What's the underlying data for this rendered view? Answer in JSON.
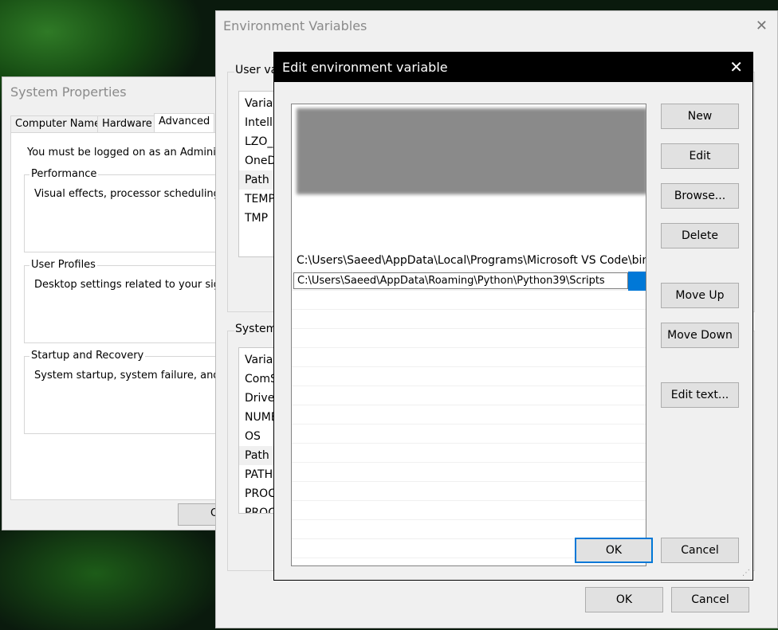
{
  "system_properties": {
    "title": "System Properties",
    "tabs": [
      "Computer Name",
      "Hardware",
      "Advanced"
    ],
    "active_tab": "Advanced",
    "admin_notice": "You must be logged on as an Administra",
    "performance": {
      "label": "Performance",
      "text": "Visual effects, processor scheduling, m"
    },
    "user_profiles": {
      "label": "User Profiles",
      "text": "Desktop settings related to your sign-i"
    },
    "startup_recovery": {
      "label": "Startup and Recovery",
      "text": "System startup, system failure, and deb"
    },
    "ok_label": "O"
  },
  "env_vars": {
    "title": "Environment Variables",
    "user_group_label": "User va",
    "user_rows": [
      "Variab",
      "Intelli",
      "LZO_D",
      "OneD",
      "Path",
      "TEMP",
      "TMP"
    ],
    "user_selected": "Path",
    "system_group_label": "System",
    "system_rows": [
      "Variab",
      "ComS",
      "Driver",
      "NUMB",
      "OS",
      "Path",
      "PATHE",
      "PROC",
      "PROC"
    ],
    "system_selected": "Path",
    "ok_label": "OK",
    "cancel_label": "Cancel"
  },
  "edit_dialog": {
    "title": "Edit environment variable",
    "paths": [
      "C:\\Users\\Saeed\\AppData\\Local\\Programs\\Microsoft VS Code\\bin",
      "C:\\Users\\Saeed\\AppData\\Roaming\\Python\\Python39\\Scripts"
    ],
    "buttons": {
      "new": "New",
      "edit": "Edit",
      "browse": "Browse...",
      "delete": "Delete",
      "move_up": "Move Up",
      "move_down": "Move Down",
      "edit_text": "Edit text..."
    },
    "ok_label": "OK",
    "cancel_label": "Cancel"
  },
  "colors": {
    "accent": "#0078d7",
    "dialog_title_bg": "#000000",
    "window_bg": "#f0f0f0"
  },
  "icons": {
    "close": "close-icon",
    "resize_grip": "resize-grip-icon"
  }
}
